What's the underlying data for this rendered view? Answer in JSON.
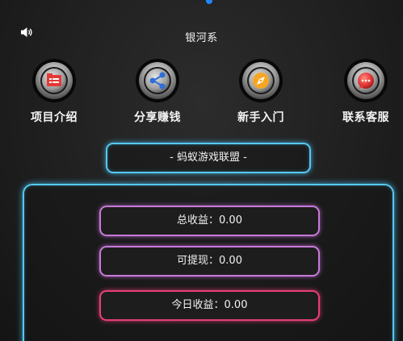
{
  "header": {
    "title": "银河系",
    "sound_icon": "speaker-icon"
  },
  "pager": {
    "active_dot_color": "#1e88ff"
  },
  "nav": [
    {
      "label": "项目介绍",
      "icon": "folder-list-icon",
      "icon_color": "#e53935"
    },
    {
      "label": "分享赚钱",
      "icon": "share-icon",
      "icon_color": "#2e6fd8"
    },
    {
      "label": "新手入门",
      "icon": "compass-icon",
      "icon_color": "#f5a623"
    },
    {
      "label": "联系客服",
      "icon": "chat-bubble-icon",
      "icon_color": "#e53935"
    }
  ],
  "banner": {
    "label": "- 蚂蚁游戏联盟 -"
  },
  "stats": {
    "total": "总收益：0.00",
    "withdrawable": "可提现：0.00",
    "today": "今日收益：0.00"
  },
  "colors": {
    "glow_blue": "#57c8ef",
    "glow_violet": "#c77ad8",
    "glow_pink": "#e63f78"
  }
}
